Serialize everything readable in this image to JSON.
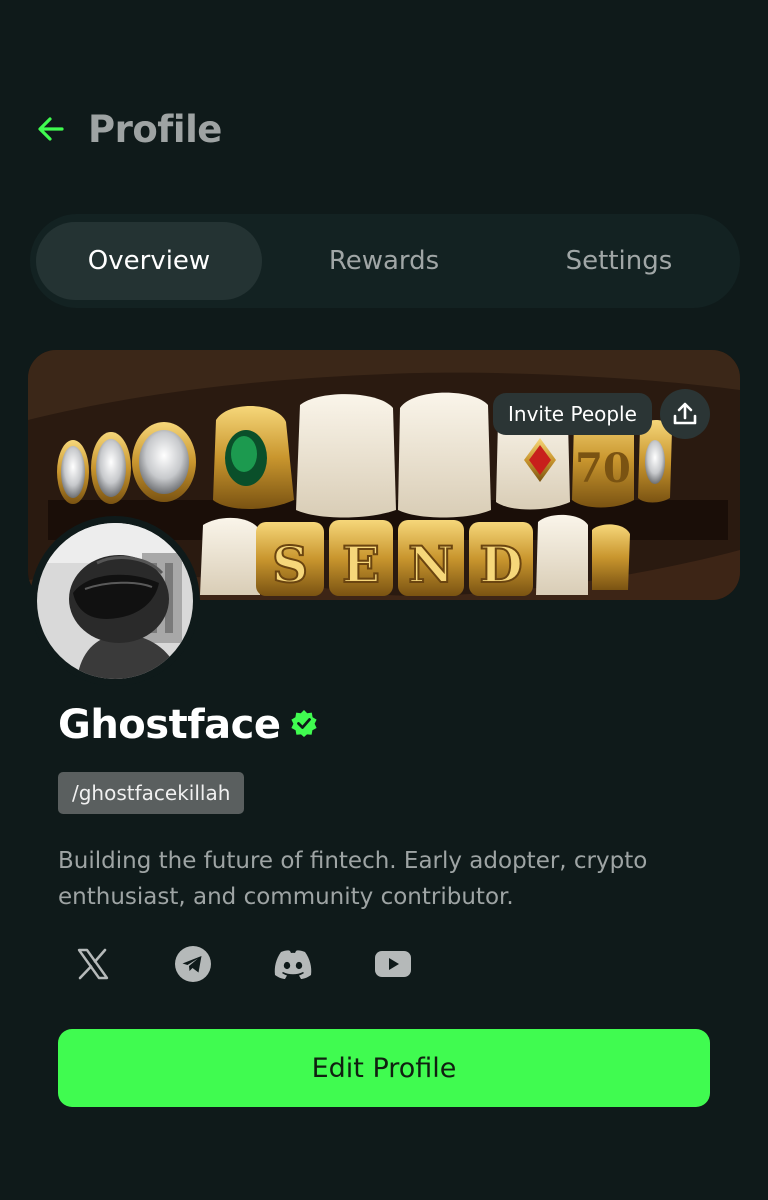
{
  "header": {
    "title": "Profile",
    "back_icon": "arrow-left-icon",
    "accent": "#40fb50"
  },
  "tabs": [
    {
      "label": "Overview",
      "active": true
    },
    {
      "label": "Rewards",
      "active": false
    },
    {
      "label": "Settings",
      "active": false
    }
  ],
  "banner": {
    "image": "gold grillz teeth photo",
    "grill_text": "SEND",
    "invite_label": "Invite People",
    "share_icon": "upload-icon"
  },
  "profile": {
    "avatar": "motorcycle helmet rider photo",
    "name": "Ghostface",
    "verified_icon": "verified-badge-icon",
    "handle": "/ghostfacekillah",
    "bio": "Building the future of fintech. Early adopter, crypto enthusiast, and community contributor."
  },
  "socials": [
    {
      "icon": "x-icon"
    },
    {
      "icon": "telegram-icon"
    },
    {
      "icon": "discord-icon"
    },
    {
      "icon": "youtube-icon"
    }
  ],
  "actions": {
    "edit_label": "Edit Profile",
    "edit_color": "#40fb50"
  }
}
